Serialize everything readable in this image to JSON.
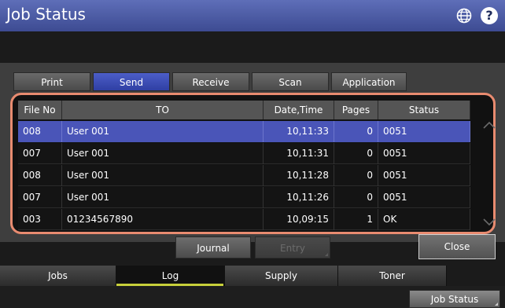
{
  "window": {
    "title": "Job Status"
  },
  "top_tabs": [
    {
      "label": "Print",
      "active": false
    },
    {
      "label": "Send",
      "active": true
    },
    {
      "label": "Receive",
      "active": false
    },
    {
      "label": "Scan",
      "active": false
    },
    {
      "label": "Application",
      "active": false
    }
  ],
  "table": {
    "columns": [
      "File No",
      "TO",
      "Date,Time",
      "Pages",
      "Status"
    ],
    "rows": [
      {
        "file_no": "008",
        "to": "User 001",
        "datetime": "10,11:33",
        "pages": "0",
        "status": "0051",
        "selected": true
      },
      {
        "file_no": "007",
        "to": "User 001",
        "datetime": "10,11:31",
        "pages": "0",
        "status": "0051",
        "selected": false
      },
      {
        "file_no": "008",
        "to": "User 001",
        "datetime": "10,11:28",
        "pages": "0",
        "status": "0051",
        "selected": false
      },
      {
        "file_no": "007",
        "to": "User 001",
        "datetime": "10,11:26",
        "pages": "0",
        "status": "0051",
        "selected": false
      },
      {
        "file_no": "003",
        "to": "01234567890",
        "datetime": "10,09:15",
        "pages": "1",
        "status": "OK",
        "selected": false
      }
    ]
  },
  "buttons": {
    "journal": "Journal",
    "entry": "Entry",
    "close": "Close"
  },
  "bottom_tabs": [
    {
      "label": "Jobs",
      "active": false
    },
    {
      "label": "Log",
      "active": true
    },
    {
      "label": "Supply",
      "active": false
    },
    {
      "label": "Toner",
      "active": false
    }
  ],
  "footer": {
    "job_status": "Job Status"
  },
  "icons": {
    "globe": "globe-icon",
    "help": "help-icon",
    "scroll_up": "chevron-up-icon",
    "scroll_down": "chevron-down-icon"
  },
  "colors": {
    "title_bar": "#4a59a6",
    "selected_row": "#4a55b8",
    "highlight_border": "#e88b70",
    "active_tab_indicator": "#c7d03b"
  }
}
